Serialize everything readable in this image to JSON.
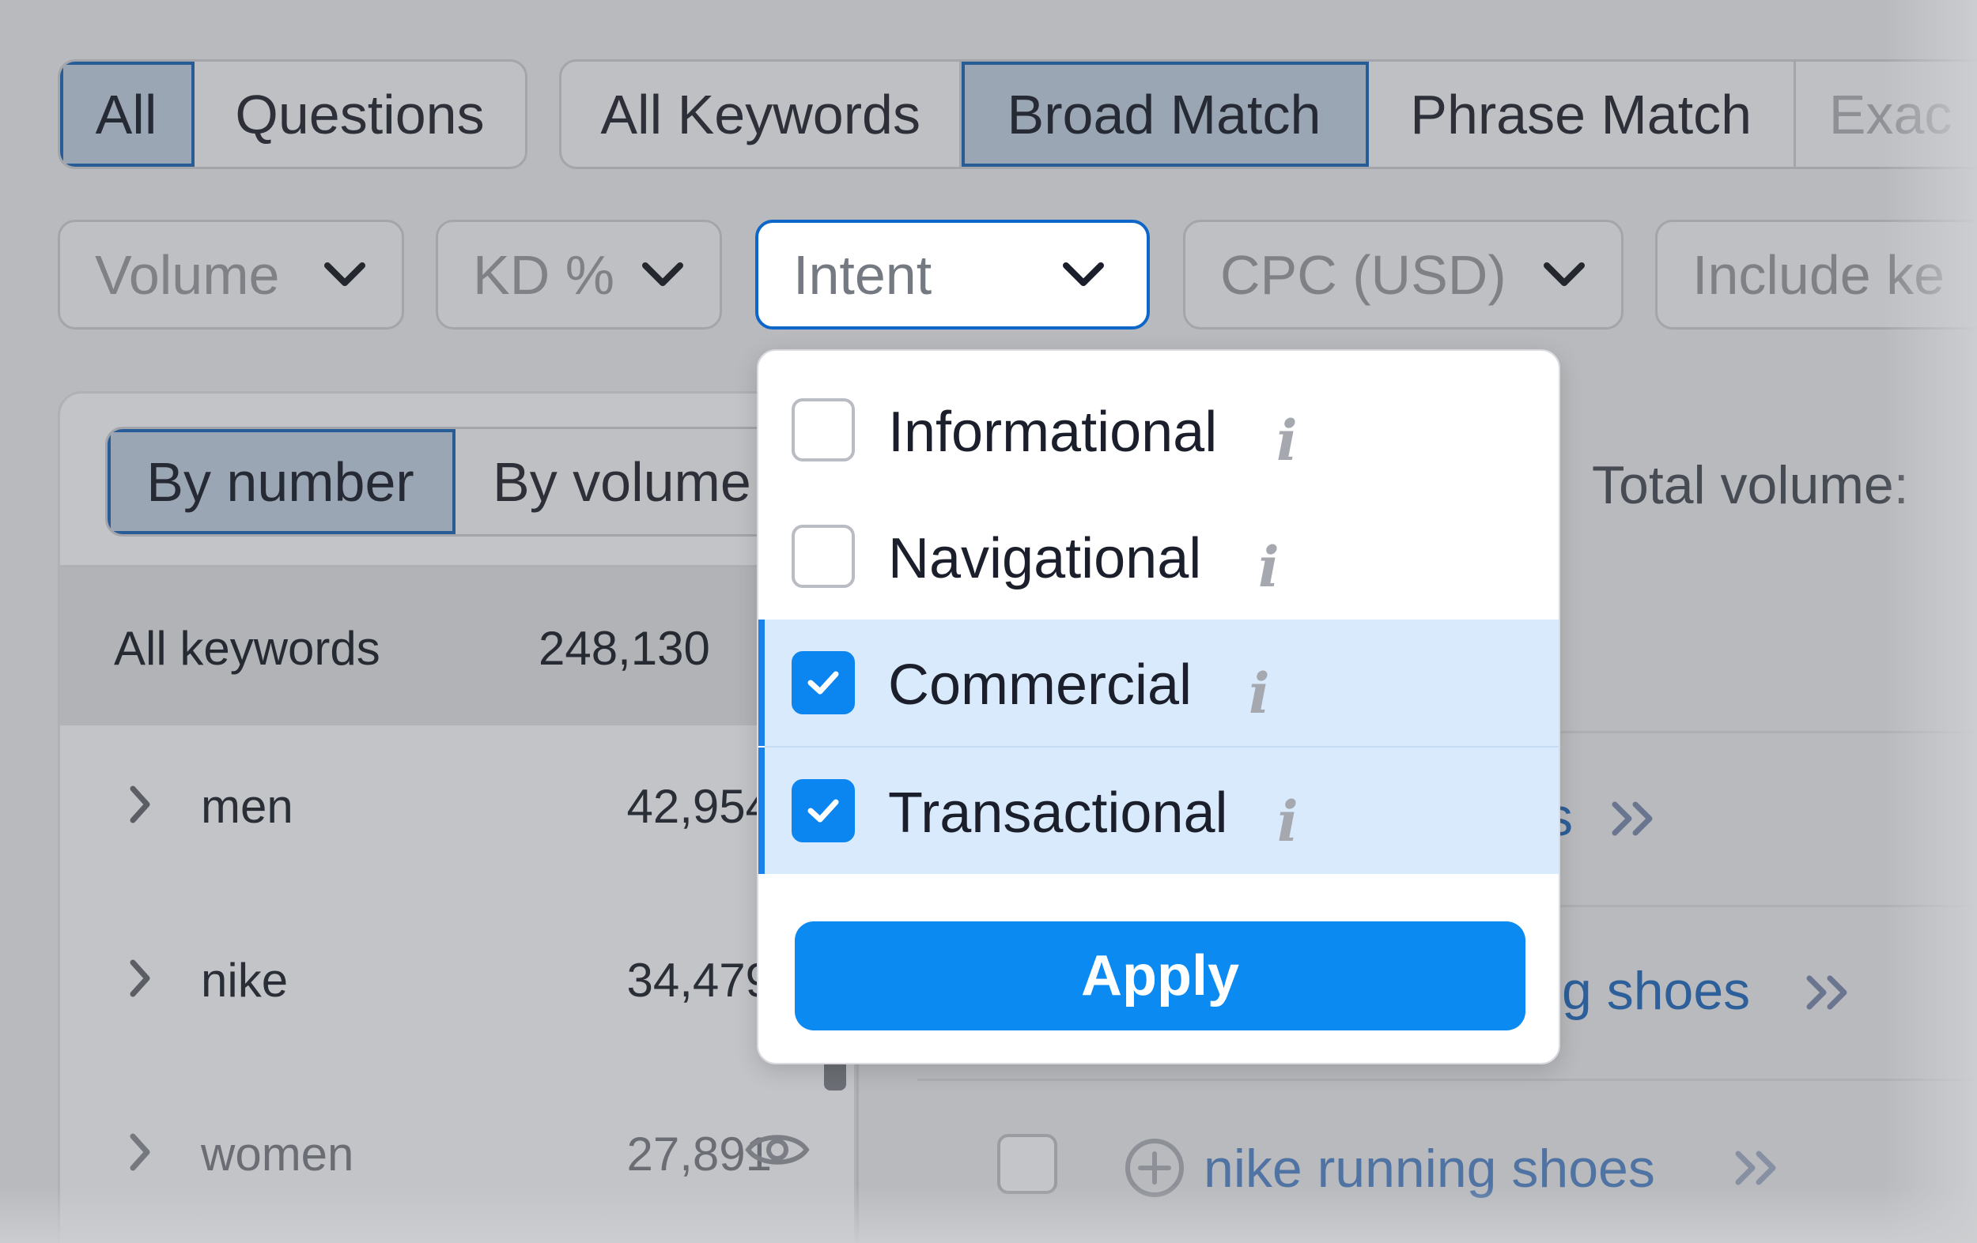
{
  "match_tabs_left": [
    {
      "label": "All",
      "active": true
    },
    {
      "label": "Questions",
      "active": false
    }
  ],
  "match_tabs_right": [
    {
      "label": "All Keywords",
      "active": false
    },
    {
      "label": "Broad Match",
      "active": true
    },
    {
      "label": "Phrase Match",
      "active": false
    },
    {
      "label": "Exac",
      "active": false
    }
  ],
  "filters": {
    "volume": "Volume",
    "kd": "KD %",
    "intent": "Intent",
    "cpc": "CPC (USD)",
    "include": "Include ke"
  },
  "group_tabs": [
    {
      "label": "By number",
      "active": true
    },
    {
      "label": "By volume",
      "active": false
    }
  ],
  "keyword_groups": {
    "all": {
      "label": "All keywords",
      "count": "248,130"
    },
    "rows": [
      {
        "label": "men",
        "count": "42,954"
      },
      {
        "label": "nike",
        "count": "34,479"
      },
      {
        "label": "women",
        "count": "27,891"
      }
    ]
  },
  "total_volume_label": "Total volume:",
  "right_links": [
    {
      "text": "s"
    },
    {
      "text": "g shoes"
    },
    {
      "text": "nike running shoes"
    }
  ],
  "intent_dropdown": {
    "options": [
      {
        "label": "Informational",
        "checked": false
      },
      {
        "label": "Navigational",
        "checked": false
      },
      {
        "label": "Commercial",
        "checked": true
      },
      {
        "label": "Transactional",
        "checked": true
      }
    ],
    "info_glyph": "i",
    "apply_label": "Apply"
  },
  "colors": {
    "accent": "#0b8af2",
    "selected_row_bg": "#d8eafb",
    "link": "#2d5f9a",
    "active_border": "#285c96"
  }
}
